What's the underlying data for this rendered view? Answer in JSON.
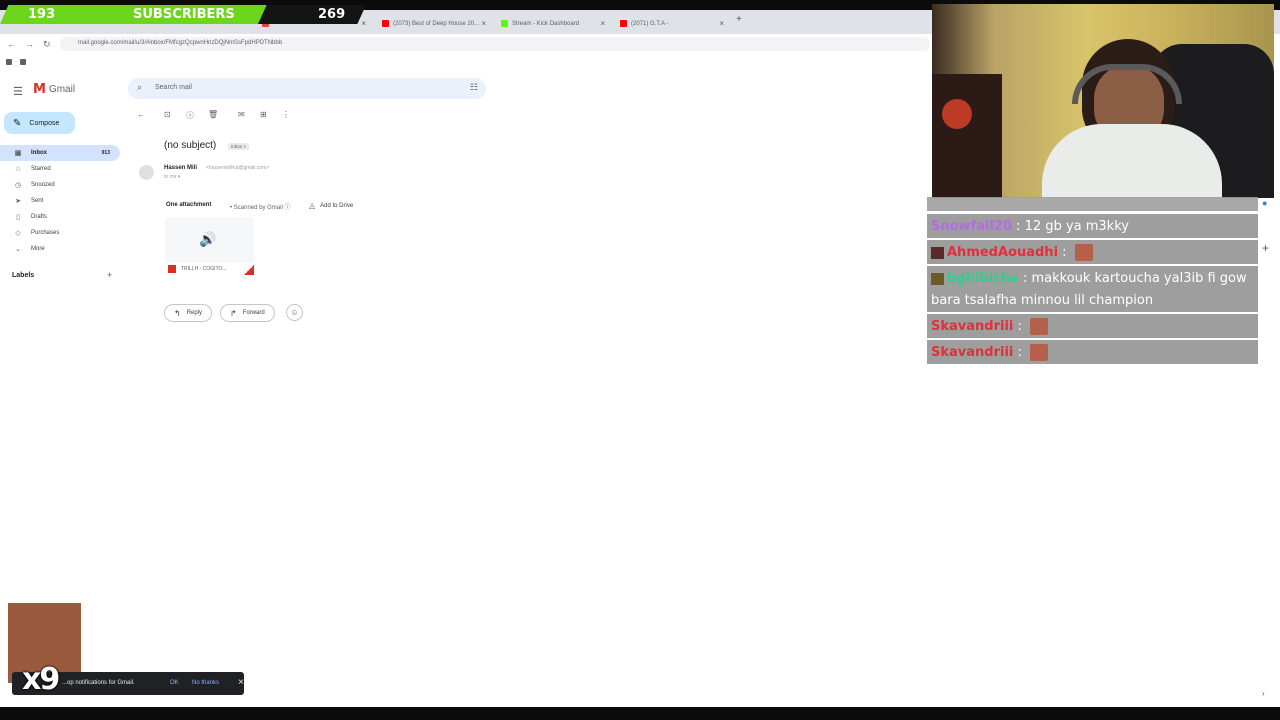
{
  "stream_overlay": {
    "subscriber_count_left": "193",
    "subscriber_label": "SUBSCRIBERS",
    "subscriber_goal": "269",
    "emote_multiplier": "x9"
  },
  "browser": {
    "tabs": [
      {
        "label": "",
        "color": "#ea4335"
      },
      {
        "label": "(2073) Best of Deep House 20...",
        "color": "#ff0000"
      },
      {
        "label": "Stream - Kick Dashboard",
        "color": "#53fc18"
      },
      {
        "label": "(2071) G.T.A - ",
        "color": "#ff0000"
      }
    ],
    "url": "mail.google.com/mail/u/3/#inbox/FMfcgzQcpwnHnzDQjNmSsFpdHPDTNbbb"
  },
  "gmail": {
    "logo_text": "Gmail",
    "search_placeholder": "Search mail",
    "compose_label": "Compose",
    "nav": [
      {
        "label": "Inbox",
        "count": "913",
        "icon": "inbox-icon"
      },
      {
        "label": "Starred",
        "count": "",
        "icon": "star-icon"
      },
      {
        "label": "Snoozed",
        "count": "",
        "icon": "clock-icon"
      },
      {
        "label": "Sent",
        "count": "",
        "icon": "send-icon"
      },
      {
        "label": "Drafts",
        "count": "",
        "icon": "draft-icon"
      },
      {
        "label": "Purchases",
        "count": "",
        "icon": "tag-icon"
      },
      {
        "label": "More",
        "count": "",
        "icon": "chevron-down-icon"
      }
    ],
    "labels_heading": "Labels",
    "message": {
      "subject": "(no subject)",
      "badge": "Inbox ×",
      "sender_name": "Hassen Mili",
      "sender_email": "<hassenmilhut@gmail.com>",
      "to": "to me ▾",
      "attachment_heading": "One attachment",
      "scanned": "• Scanned by Gmail ⓘ",
      "add_to_drive": "Add to Drive",
      "attachment_name": "TRILLH - COGITO...",
      "reply": "Reply",
      "forward": "Forward"
    }
  },
  "chat": {
    "messages": [
      {
        "user": "Snowfall20",
        "user_color": "#b46be8",
        "text": " : 12 gb ya m3kky",
        "emote": false
      },
      {
        "user": "AhmedAouadhi",
        "user_color": "#e0303a",
        "text": " : ",
        "emote": true
      },
      {
        "user": "bghibicha",
        "user_color": "#2fcf8f",
        "text": " : makkouk kartoucha yal3ib fi gow bara tsalafha minnou lil champion",
        "emote": false
      },
      {
        "user": "Skavandriii",
        "user_color": "#e0303a",
        "text": " : ",
        "emote": true
      },
      {
        "user": "Skavandriii",
        "user_color": "#e0303a",
        "text": " : ",
        "emote": true
      }
    ]
  },
  "notification": {
    "message": "...op notifications for Gmail.",
    "ok": "OK",
    "no_thanks": "No thanks"
  }
}
